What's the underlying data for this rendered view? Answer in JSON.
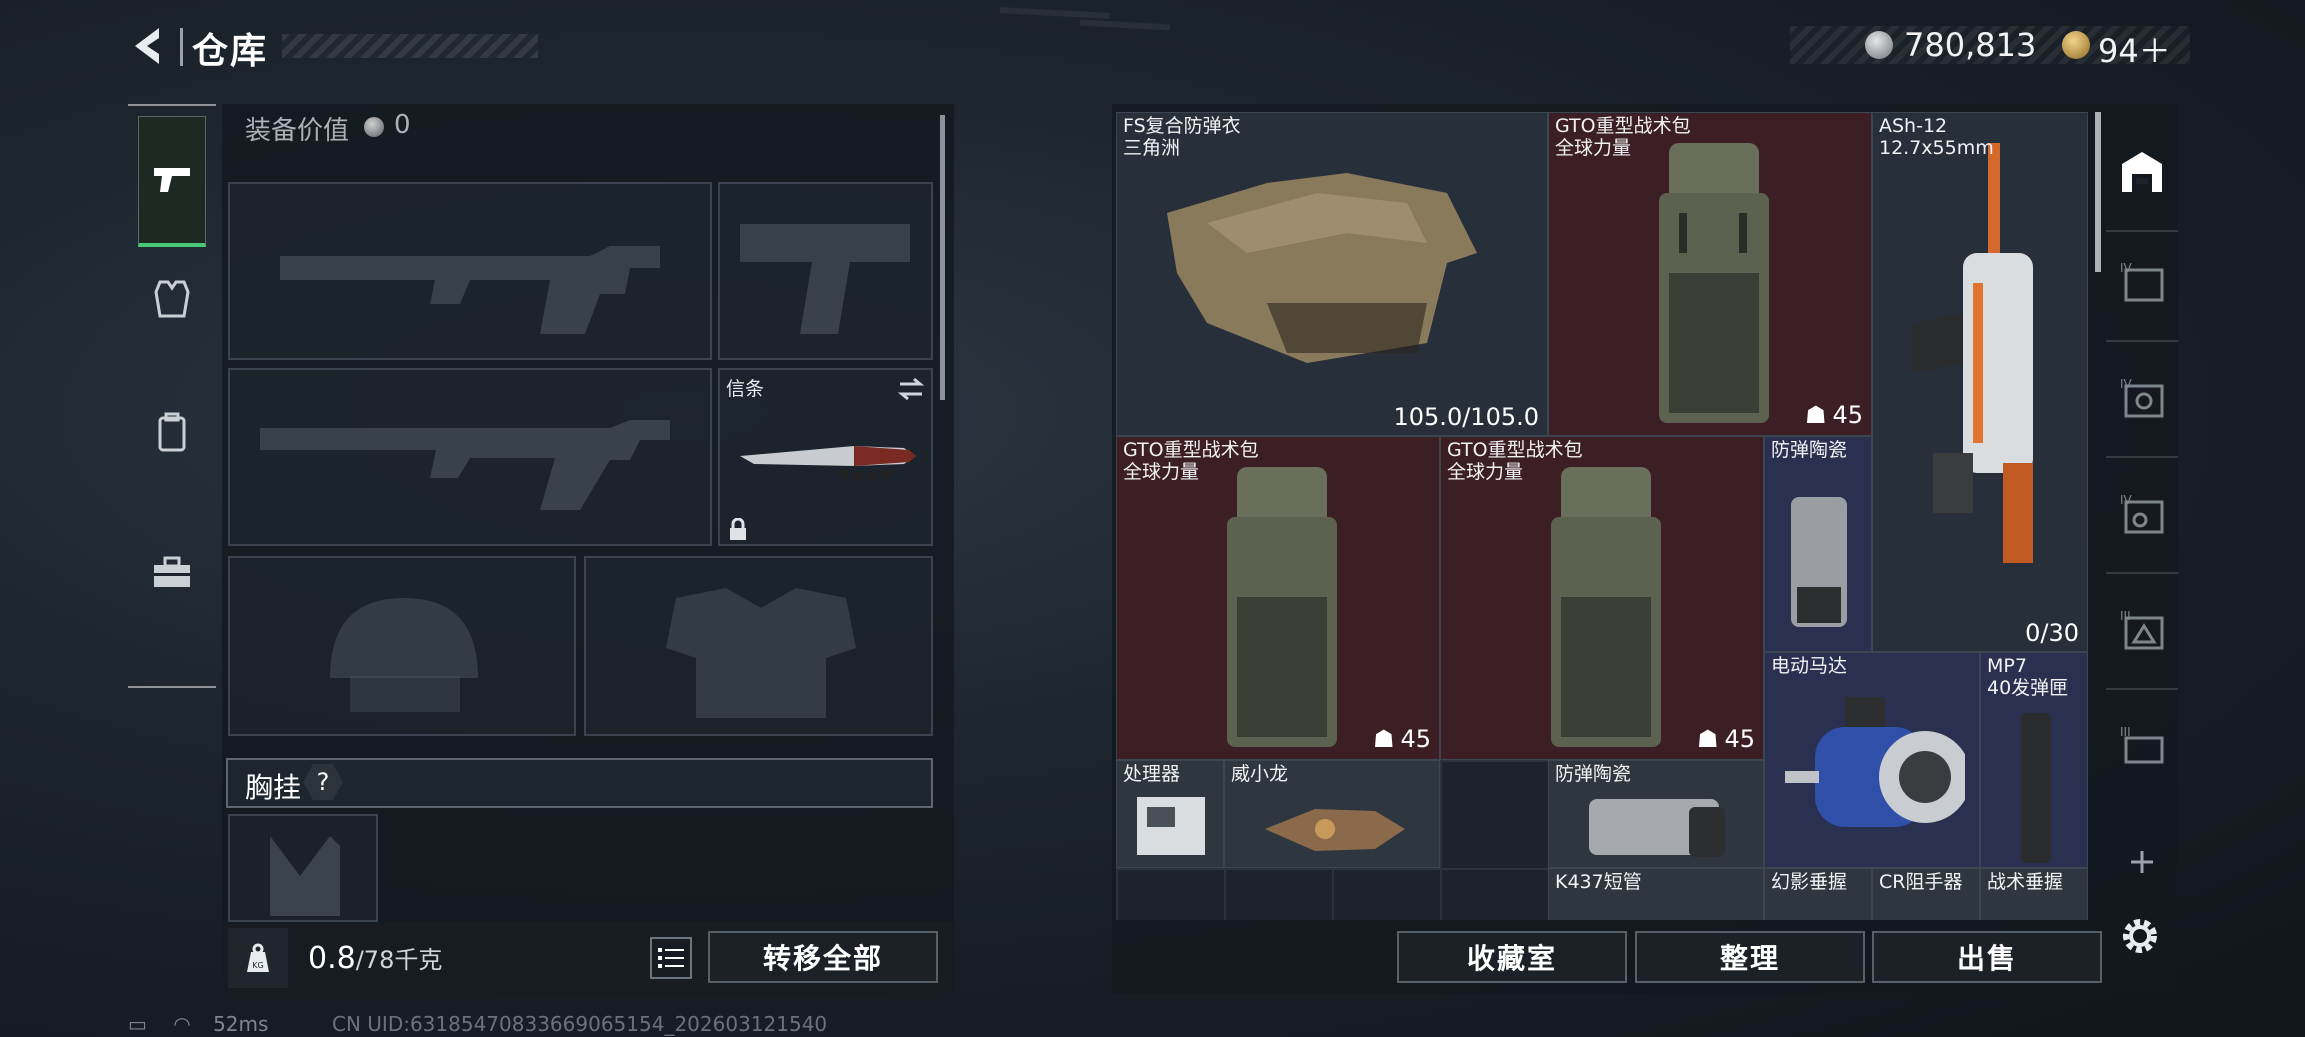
{
  "header": {
    "title": "仓库",
    "money": "780,813",
    "tokens": "94＋"
  },
  "left": {
    "equip_value_label": "装备价值",
    "equip_value": "0",
    "melee_slot_label": "信条",
    "chest_label": "胸挂",
    "chest_help": "?",
    "weight_value": "0.8",
    "weight_unit": "/78千克",
    "transfer_all": "转移全部"
  },
  "stash": {
    "items": [
      {
        "name": "FS复合防弹衣\n三角洲",
        "value": "105.0/105.0"
      },
      {
        "name": "GTO重型战术包\n全球力量",
        "value": "45"
      },
      {
        "name": "ASh-12\n12.7x55mm",
        "value": "0/30"
      },
      {
        "name": "GTO重型战术包\n全球力量",
        "value": "45"
      },
      {
        "name": "GTO重型战术包\n全球力量",
        "value": "45"
      },
      {
        "name": "防弹陶瓷"
      },
      {
        "name": "电动马达"
      },
      {
        "name": "MP7\n40发弹匣"
      },
      {
        "name": "处理器"
      },
      {
        "name": "威小龙"
      },
      {
        "name": "防弹陶瓷"
      },
      {
        "name": "K437短管"
      },
      {
        "name": "幻影垂握"
      },
      {
        "name": "CR阻手器"
      },
      {
        "name": "战术垂握"
      }
    ],
    "buttons": {
      "collection": "收藏室",
      "sort": "整理",
      "sell": "出售"
    }
  },
  "status": {
    "ping": "52ms",
    "uid": "CN UID:631854708336690651​54_202603121540"
  }
}
